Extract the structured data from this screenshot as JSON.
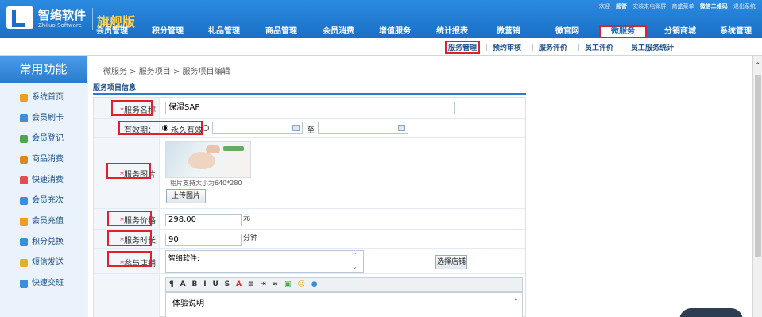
{
  "header": {
    "logo_name": "智络软件",
    "logo_en": "Zhiluo Software",
    "edition": "旗舰版",
    "toplinks": [
      {
        "text": "欢迎",
        "strong": false
      },
      {
        "text": "超管",
        "strong": true
      },
      {
        "text": "安装来电弹屏",
        "strong": false
      },
      {
        "text": "商盛菜单",
        "strong": false
      },
      {
        "text": "微信二维码",
        "strong": true
      },
      {
        "text": "退出系统",
        "strong": false
      }
    ],
    "nav": [
      "会员管理",
      "积分管理",
      "礼品管理",
      "商品管理",
      "会员消费",
      "增值服务",
      "统计报表",
      "微营销",
      "微官网",
      "微服务",
      "分销商城",
      "系统管理"
    ],
    "active_nav": "微服务"
  },
  "subnav": [
    "服务管理",
    "预约审核",
    "服务评价",
    "员工评价",
    "员工服务统计"
  ],
  "sidebar": {
    "title": "常用功能",
    "items": [
      {
        "label": "系统首页",
        "icon": "home-icon",
        "color": "#e8a020"
      },
      {
        "label": "会员刷卡",
        "icon": "member-card-icon",
        "color": "#3a8fd8"
      },
      {
        "label": "会员登记",
        "icon": "member-register-icon",
        "color": "#4aa84a"
      },
      {
        "label": "商品消费",
        "icon": "cart-icon",
        "color": "#d88a20"
      },
      {
        "label": "快速消费",
        "icon": "quick-consume-icon",
        "color": "#e05050"
      },
      {
        "label": "会员充次",
        "icon": "recharge-times-icon",
        "color": "#3a8fd8"
      },
      {
        "label": "会员充值",
        "icon": "recharge-icon",
        "color": "#e8a020"
      },
      {
        "label": "积分兑换",
        "icon": "points-exchange-icon",
        "color": "#3a8fd8"
      },
      {
        "label": "短信发送",
        "icon": "sms-icon",
        "color": "#e8b020"
      },
      {
        "label": "快速交班",
        "icon": "shift-handover-icon",
        "color": "#3a8fd8"
      }
    ]
  },
  "main": {
    "breadcrumb": "微服务 > 服务项目 > 服务项目编辑",
    "section_title": "服务项目信息",
    "form": {
      "name_label": "服务名称",
      "name_value": "保湿SAP",
      "validity_label": "有效期：",
      "validity_option": "永久有效",
      "validity_to": "至",
      "image_label": "服务图片",
      "image_hint": "相片支持大小为640*280",
      "upload_button": "上传图片",
      "price_label": "服务价格",
      "price_value": "298.00",
      "price_unit": "元",
      "duration_label": "服务时长",
      "duration_value": "90",
      "duration_unit": "分钟",
      "store_label": "参与店铺",
      "store_value": "智络软件;",
      "select_store_button": "选择店铺",
      "editor_text": "体验说明"
    }
  }
}
